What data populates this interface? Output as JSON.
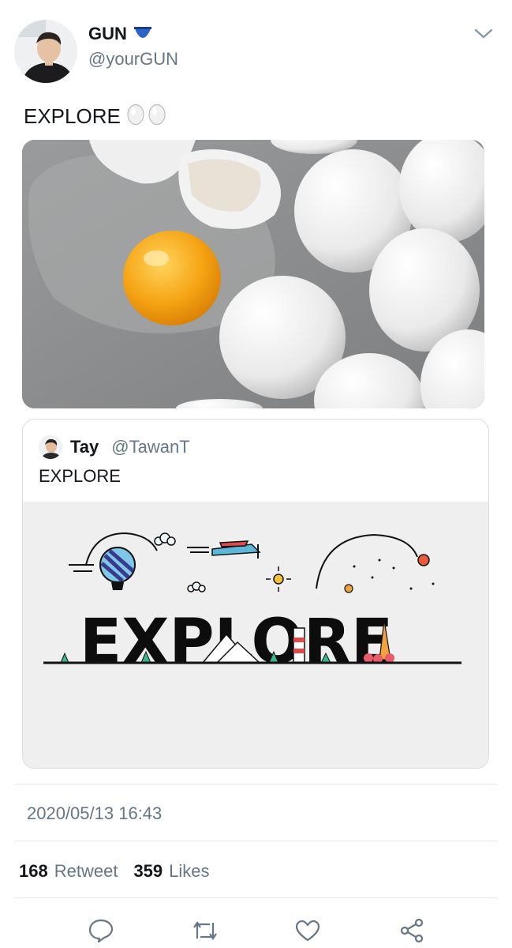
{
  "author": {
    "name": "GUN",
    "handle": "@yourGUN"
  },
  "tweet": {
    "text": "EXPLORE"
  },
  "quoted": {
    "name": "Tay",
    "handle": "@TawanT",
    "text": "EXPLORE",
    "image_word": "EXPLORE"
  },
  "meta": {
    "timestamp": "2020/05/13 16:43"
  },
  "stats": {
    "retweets": "168",
    "retweets_label": "Retweet",
    "likes": "359",
    "likes_label": "Likes"
  },
  "icons": {
    "verified": "underwear-emoji-icon",
    "menu": "chevron-down-icon",
    "reply": "reply-icon",
    "retweet": "retweet-icon",
    "like": "heart-icon",
    "share": "share-icon"
  },
  "colors": {
    "accent": "#1da1f2",
    "muted": "#657786"
  }
}
